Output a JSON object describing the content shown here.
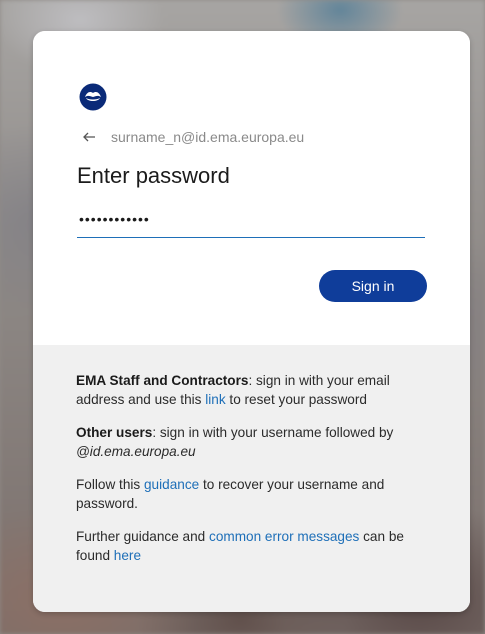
{
  "login": {
    "identity_email": "surname_n@id.ema.europa.eu",
    "title": "Enter password",
    "password_value": "••••••••••••",
    "signin_label": "Sign in"
  },
  "help": {
    "p1": {
      "bold": "EMA Staff and Contractors",
      "text_before_link": ": sign in with your email address and use this ",
      "link": "link",
      "text_after_link": " to reset your password"
    },
    "p2": {
      "bold": "Other users",
      "text": ": sign in with your username followed by ",
      "italic": "@id.ema.europa.eu"
    },
    "p3": {
      "text_before_link": "Follow this ",
      "link": "guidance",
      "text_after_link": " to recover your username and password."
    },
    "p4": {
      "text_before_link": "Further guidance and ",
      "link": "common error messages",
      "text_middle": " can be found ",
      "link2": "here"
    }
  },
  "colors": {
    "accent": "#0f3d9a",
    "link": "#1e6fb8",
    "footer_bg": "#f0f0f0"
  },
  "icons": {
    "logo": "organization-logo-icon",
    "back": "back-arrow-icon"
  }
}
